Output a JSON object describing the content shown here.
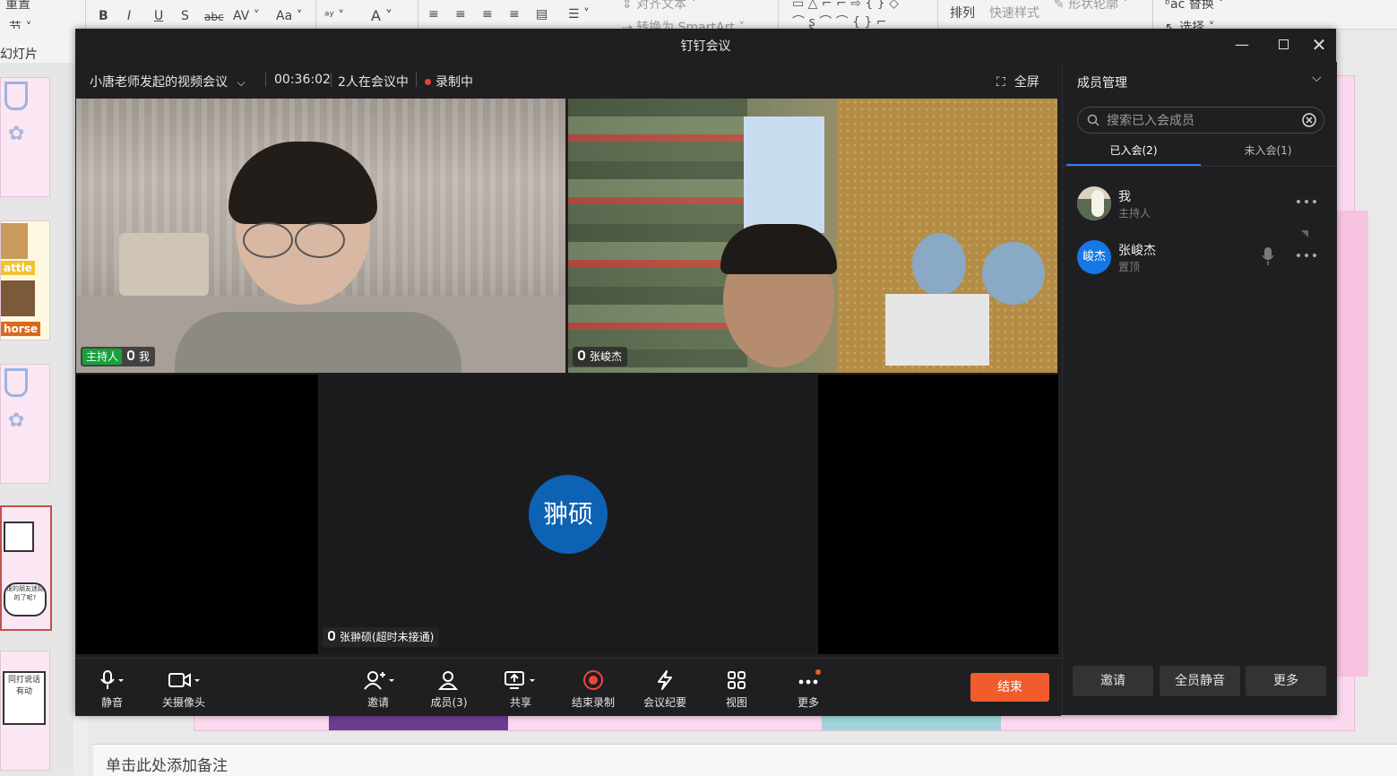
{
  "ppt": {
    "ribbon": {
      "reset": "重置",
      "section": "节",
      "arrange": "排列",
      "quick_styles": "快速样式",
      "shape_outline": "形状轮廓",
      "align_text": "对齐文本",
      "convert_smartart": "转换为 SmartArt",
      "replace": "替换",
      "select": "选择"
    },
    "slides_label": "幻灯片",
    "thumb_tags": [
      "attle",
      "horse"
    ],
    "thumb_texts": [
      "谁的朋友迷路的了呢?",
      "同打说话有动"
    ],
    "notes_placeholder": "单击此处添加备注"
  },
  "meeting": {
    "window_title": "钉钉会议",
    "info": {
      "meeting_name": "小唐老师发起的视频会议",
      "duration": "00:36:02",
      "participants": "2人在会议中",
      "recording": "录制中",
      "fullscreen": "全屏"
    },
    "videos": [
      {
        "host_badge": "主持人",
        "name": "我"
      },
      {
        "name": "张峻杰"
      },
      {
        "avatar_text": "翀硕",
        "name": "张翀硕(超时未接通)"
      }
    ],
    "toolbar": {
      "mute": "静音",
      "camera_off": "关摄像头",
      "invite": "邀请",
      "members": "成员(3)",
      "share": "共享",
      "stop_record": "结束录制",
      "minutes": "会议纪要",
      "view": "视图",
      "more": "更多",
      "end": "结束"
    },
    "panel": {
      "title": "成员管理",
      "search_placeholder": "搜索已入会成员",
      "tab_joined": "已入会(2)",
      "tab_not_joined": "未入会(1)",
      "members": [
        {
          "name": "我",
          "role": "主持人"
        },
        {
          "name": "张峻杰",
          "role": "置顶",
          "avatar_text": "峻杰"
        }
      ],
      "btn_invite": "邀请",
      "btn_mute_all": "全员静音",
      "btn_more": "更多"
    },
    "colors": {
      "accent": "#2f7cf6",
      "end_button": "#f25b2b",
      "host_badge": "#17a23b",
      "avatar": "#0d62b4"
    }
  }
}
